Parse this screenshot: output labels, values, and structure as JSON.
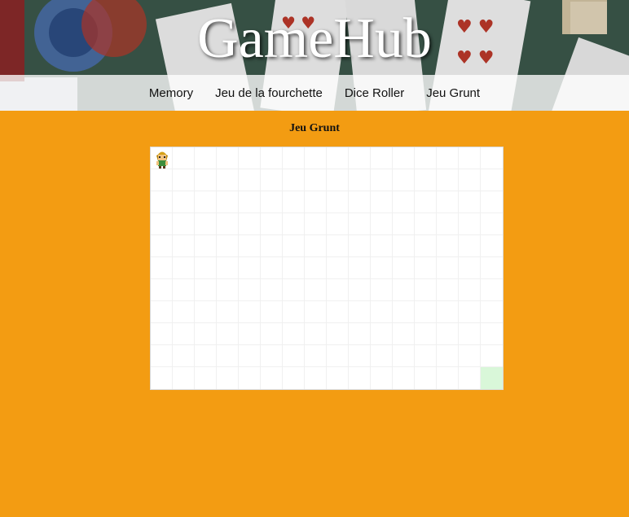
{
  "site": {
    "title": "GameHub"
  },
  "nav": {
    "items": [
      {
        "label": "Memory"
      },
      {
        "label": "Jeu de la fourchette"
      },
      {
        "label": "Dice Roller"
      },
      {
        "label": "Jeu Grunt"
      }
    ]
  },
  "game": {
    "heading": "Jeu Grunt",
    "grid": {
      "columns": 16,
      "rows": 11
    },
    "player_cell": {
      "column": 1,
      "row": 1
    },
    "goal_cell": {
      "column": 16,
      "row": 11
    }
  },
  "colors": {
    "page_background": "#f39c12",
    "goal_cell": "#d9f7d9",
    "board_background": "#ffffff"
  },
  "icons": {
    "player": "player-sprite-icon"
  }
}
